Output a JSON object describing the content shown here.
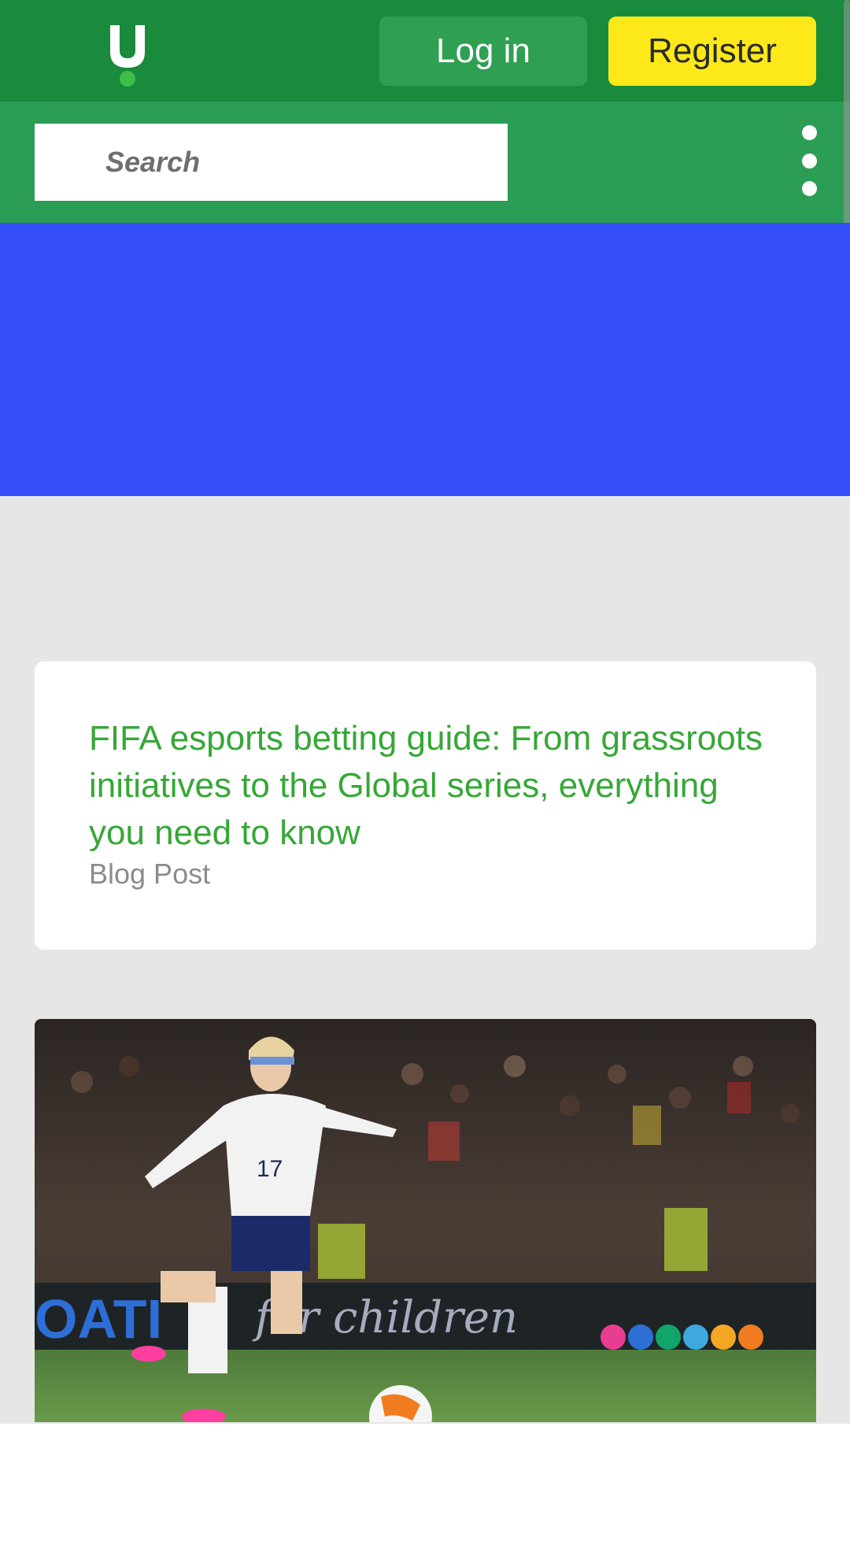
{
  "header": {
    "logo_letter": "U",
    "login_label": "Log in",
    "register_label": "Register"
  },
  "search": {
    "placeholder": "Search"
  },
  "menu": {
    "icon": "kebab-menu-icon"
  },
  "hero": {
    "color": "#344efc"
  },
  "card": {
    "title": "FIFA esports betting guide: From grassroots initiatives to the Global series, everything you need to know",
    "type": "Blog Post"
  },
  "photo": {
    "banner_text": "for children",
    "shirt_number": "17"
  },
  "colors": {
    "top_bar": "#1a8a3c",
    "search_bar": "#2c9d55",
    "login_button": "#2f9f52",
    "register_button": "#fde919",
    "title_green": "#36a737"
  }
}
